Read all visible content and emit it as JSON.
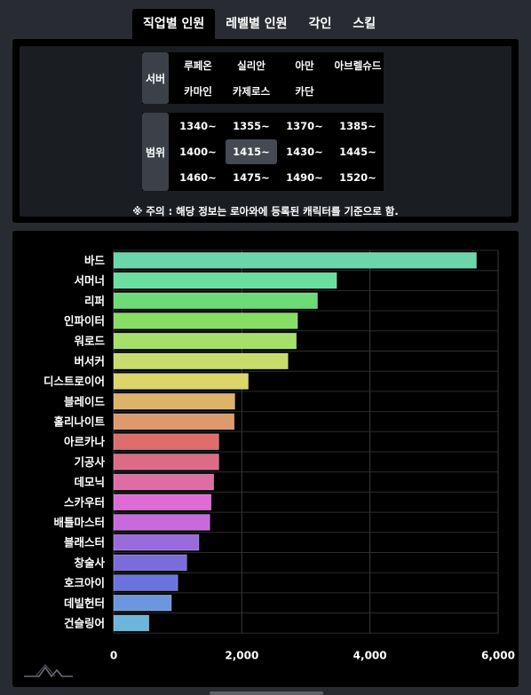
{
  "tabs": [
    {
      "label": "직업별 인원",
      "active": true
    },
    {
      "label": "레벨별 인원",
      "active": false
    },
    {
      "label": "각인",
      "active": false
    },
    {
      "label": "스킬",
      "active": false
    }
  ],
  "filters": {
    "server": {
      "label": "서버",
      "options": [
        "루페온",
        "실리안",
        "아만",
        "아브렐슈드",
        "카마인",
        "카제로스",
        "카단"
      ]
    },
    "range": {
      "label": "범위",
      "options": [
        "1340~",
        "1355~",
        "1370~",
        "1385~",
        "1400~",
        "1415~",
        "1430~",
        "1445~",
        "1460~",
        "1475~",
        "1490~",
        "1520~"
      ],
      "selected": "1415~"
    },
    "notice": "※ 주의 : 해당 정보는 로아와에 등록된 캐릭터를 기준으로 함."
  },
  "chart_data": {
    "type": "bar",
    "orientation": "horizontal",
    "categories": [
      "바드",
      "서머너",
      "리퍼",
      "인파이터",
      "워로드",
      "버서커",
      "디스트로이어",
      "블레이드",
      "홀리나이트",
      "아르카나",
      "기공사",
      "데모닉",
      "스카우터",
      "배틀마스터",
      "블래스터",
      "창술사",
      "호크아이",
      "데빌헌터",
      "건슬링어"
    ],
    "values": [
      5660,
      3480,
      3180,
      2870,
      2850,
      2720,
      2100,
      1890,
      1880,
      1640,
      1640,
      1560,
      1520,
      1500,
      1330,
      1140,
      1000,
      900,
      550
    ],
    "colors": [
      "#6ad6a9",
      "#6adf9f",
      "#6ddc78",
      "#86de64",
      "#a4e06a",
      "#c8dc6c",
      "#dcd66a",
      "#ddb36a",
      "#de9a6c",
      "#de6d6c",
      "#dd6b86",
      "#df6da4",
      "#de6cd4",
      "#c86ade",
      "#9a6bde",
      "#7b6cde",
      "#6b74de",
      "#6c97de",
      "#6cb6de"
    ],
    "xlim": [
      0,
      6000
    ],
    "xticks": [
      0,
      2000,
      4000,
      6000
    ],
    "xtick_labels": [
      "0",
      "2,000",
      "4,000",
      "6,000"
    ],
    "grid": true,
    "legend": "none"
  }
}
